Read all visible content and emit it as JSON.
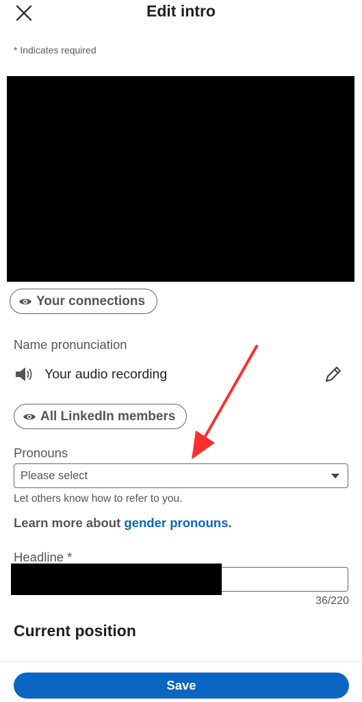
{
  "header": {
    "title": "Edit intro",
    "close_icon": "close-icon"
  },
  "form": {
    "required_note": "* Indicates required",
    "photo_visibility_label": "Your connections",
    "name_pronunciation": {
      "label": "Name pronunciation",
      "audio_text": "Your audio recording",
      "visibility_label": "All LinkedIn members"
    },
    "pronouns": {
      "label": "Pronouns",
      "placeholder": "Please select",
      "helper": "Let others know how to refer to you.",
      "learn_prefix": "Learn more about ",
      "learn_link": "gender pronouns",
      "learn_suffix": "."
    },
    "headline": {
      "label": "Headline *",
      "counter": "36/220"
    },
    "current_position_title": "Current position"
  },
  "footer": {
    "save_label": "Save"
  },
  "colors": {
    "accent": "#0a66c2",
    "annotation_arrow": "#ff2d2d"
  }
}
